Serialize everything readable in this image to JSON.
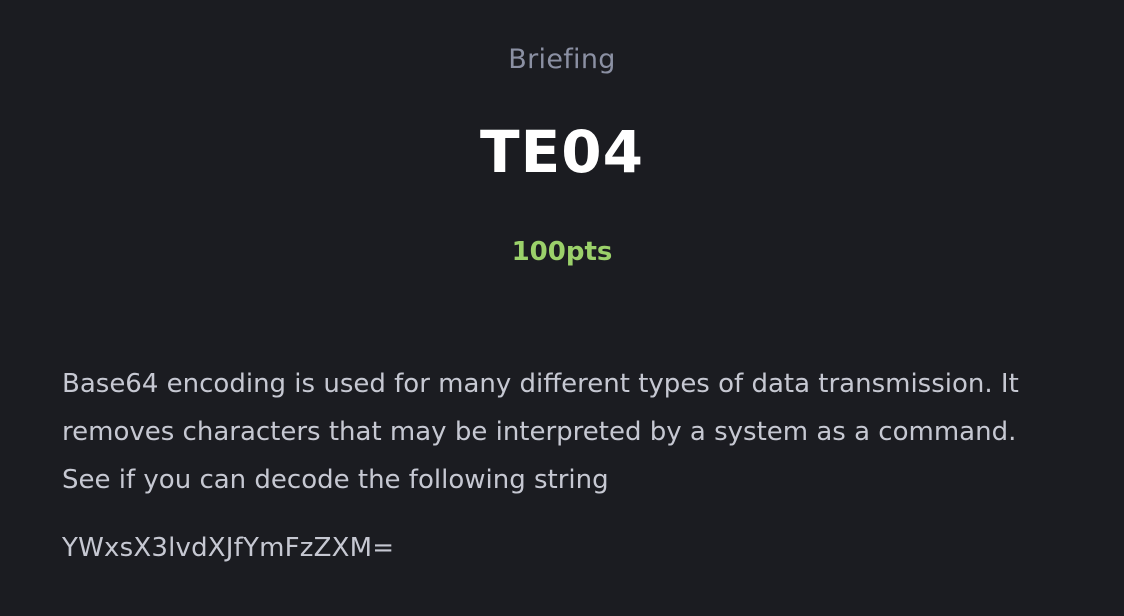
{
  "briefing": {
    "label": "Briefing",
    "title": "TE04",
    "points": "100pts",
    "description": "Base64 encoding is used for many different types of data transmission. It removes characters that may be interpreted by a system as a command. See if you can decode the following string",
    "encoded_string": "YWxsX3lvdXJfYmFzZXM="
  },
  "colors": {
    "background": "#1b1c21",
    "label": "#8b90a3",
    "title": "#ffffff",
    "points": "#9bd16a",
    "body_text": "#c6c8d2"
  }
}
